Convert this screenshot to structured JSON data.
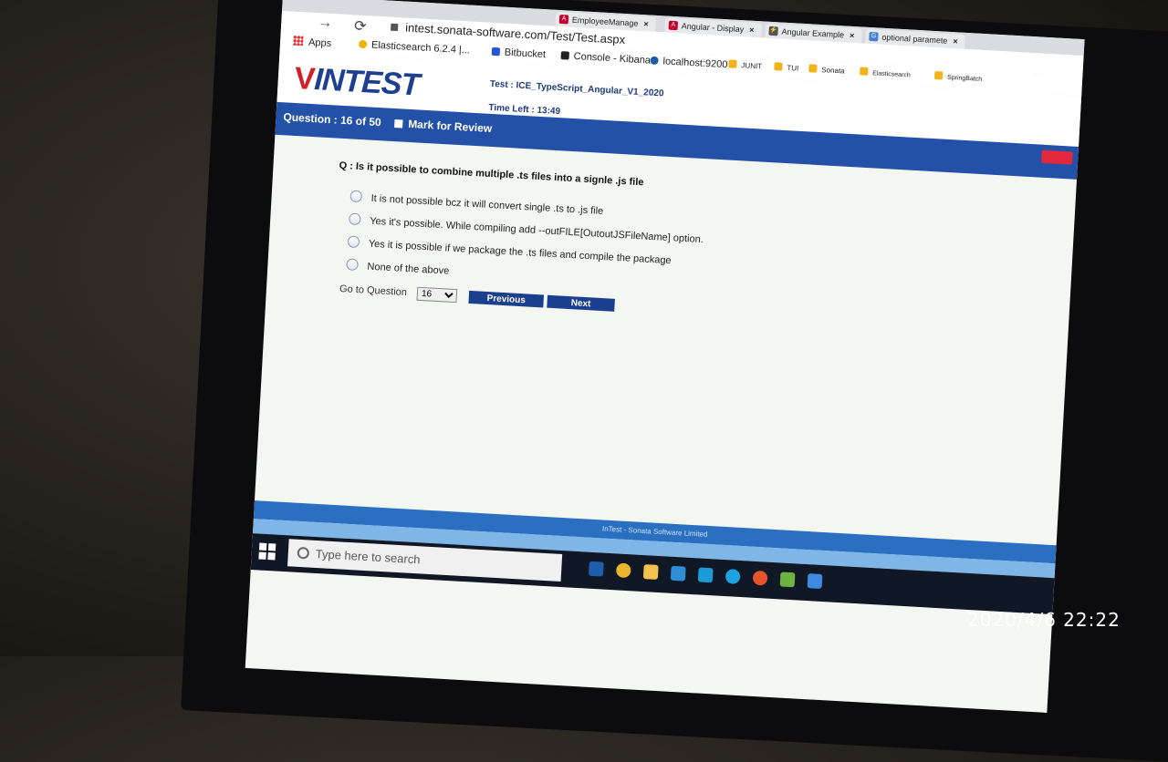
{
  "browser": {
    "tabs": [
      {
        "label": "EmployeeManage",
        "icon": "angular-icon"
      },
      {
        "label": "Angular - Display",
        "icon": "angular-icon"
      },
      {
        "label": "Angular Example",
        "icon": "bolt-icon"
      },
      {
        "label": "optional paramete",
        "icon": "google-icon"
      }
    ],
    "url": "intest.sonata-software.com/Test/Test.aspx",
    "bookmarks": [
      {
        "label": "Apps",
        "icon": "apps-grid-icon"
      },
      {
        "label": "Elasticsearch 6.2.4 |...",
        "icon": "elasticsearch-icon",
        "color": "#f0b400"
      },
      {
        "label": "Bitbucket",
        "icon": "bitbucket-icon",
        "color": "#2356d4"
      },
      {
        "label": "Console - Kibana",
        "icon": "kibana-icon",
        "color": "#222222"
      },
      {
        "label": "localhost:9200",
        "icon": "edge-icon",
        "color": "#1c5fa8"
      },
      {
        "label": "JUNIT",
        "icon": "folder-icon",
        "color": "#f2b21a"
      },
      {
        "label": "TUI",
        "icon": "folder-icon",
        "color": "#f2b21a"
      },
      {
        "label": "Sonata",
        "icon": "folder-icon",
        "color": "#f2b21a"
      },
      {
        "label": "Elasticsearch",
        "icon": "folder-icon",
        "color": "#f2b21a"
      },
      {
        "label": "SpringBatch",
        "icon": "folder-icon",
        "color": "#f2b21a"
      }
    ]
  },
  "header": {
    "logo_mark": "V",
    "logo_text": "INTEST",
    "test_label": "Test : ICE_TypeScript_Angular_V1_2020",
    "time_label": "Time Left : 13:49"
  },
  "question_bar": {
    "question_counter": "Question : 16 of 50",
    "mark_for_review": "Mark for Review"
  },
  "question": {
    "text": "Q :  Is it possible to combine multiple .ts files into a signle .js file",
    "options": [
      "It is not possible bcz it will convert single .ts to .js file",
      "Yes it's possible. While compiling add --outFILE[OutoutJSFileName] option.",
      "Yes it is possible if we package the .ts files and compile the package",
      "None of the above"
    ]
  },
  "navigation": {
    "goto_label": "Go to Question",
    "goto_value": "16",
    "previous_label": "Previous",
    "next_label": "Next"
  },
  "footer": {
    "text": "InTest - Sonata Software Limited"
  },
  "taskbar": {
    "search_placeholder": "Type here to search"
  },
  "photo": {
    "timestamp": "2020/4/6  22:22"
  },
  "colors": {
    "brand_blue": "#2451a8",
    "button_blue": "#1a3f8e",
    "logo_red": "#d21f2a"
  }
}
